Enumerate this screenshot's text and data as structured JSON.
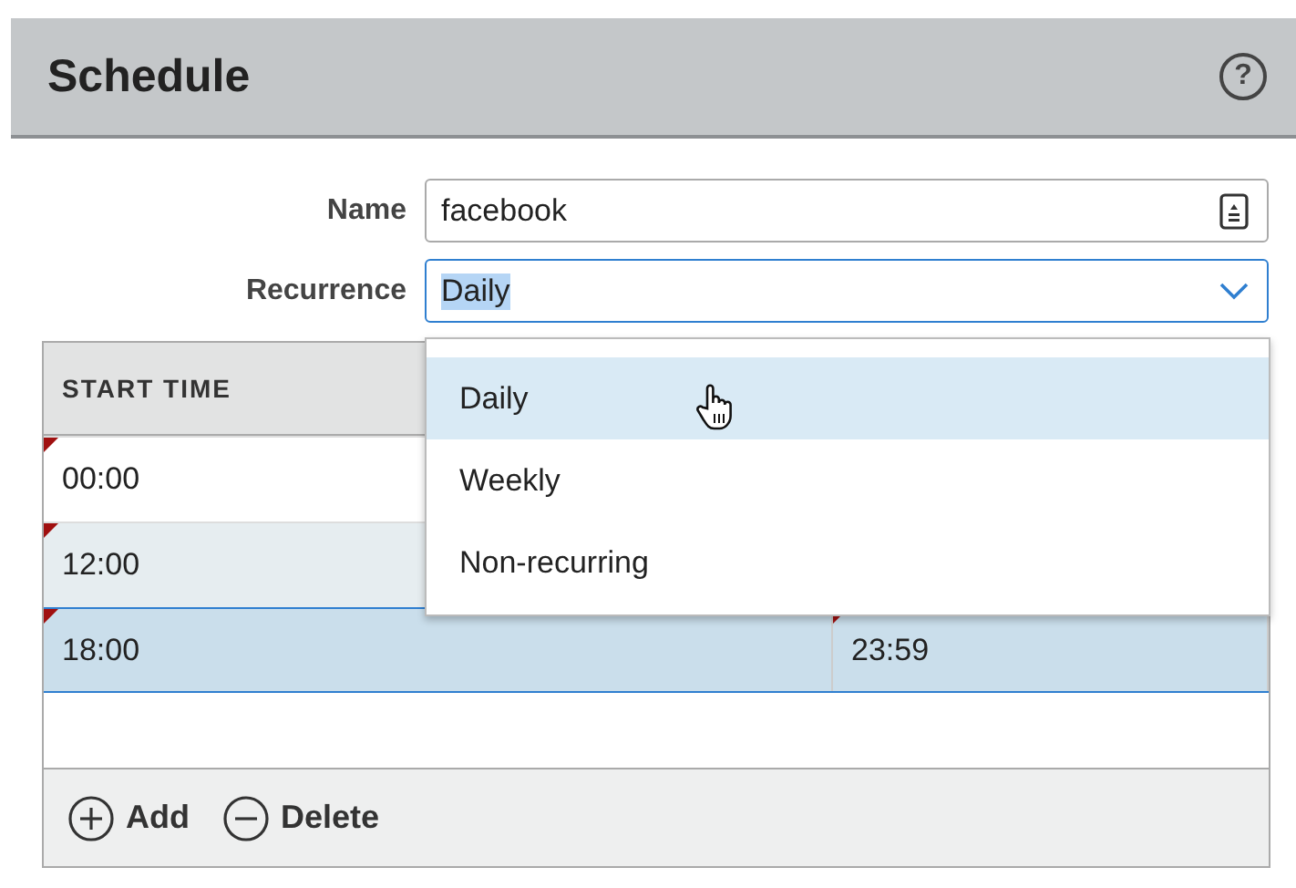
{
  "dialog": {
    "title": "Schedule",
    "help": "?"
  },
  "form": {
    "name_label": "Name",
    "name_value": "facebook",
    "recurrence_label": "Recurrence",
    "recurrence_value": "Daily",
    "recurrence_value_highlighted": true
  },
  "dropdown": {
    "open": true,
    "options": [
      {
        "label": "Daily",
        "selected": true
      },
      {
        "label": "Weekly",
        "selected": false
      },
      {
        "label": "Non-recurring",
        "selected": false
      }
    ]
  },
  "table": {
    "columns": [
      "START TIME"
    ],
    "rows": [
      {
        "selected": false,
        "striped": false,
        "cells": [
          {
            "text": "00:00",
            "edited": true
          }
        ]
      },
      {
        "selected": false,
        "striped": true,
        "cells": [
          {
            "text": "12:00",
            "edited": true
          }
        ]
      },
      {
        "selected": true,
        "striped": false,
        "cells": [
          {
            "text": "18:00",
            "edited": true
          },
          {
            "text": "23:59",
            "edited": true
          }
        ]
      }
    ]
  },
  "footer": {
    "buttons": [
      {
        "kind": "add",
        "label": "Add"
      },
      {
        "kind": "delete",
        "label": "Delete"
      }
    ]
  }
}
